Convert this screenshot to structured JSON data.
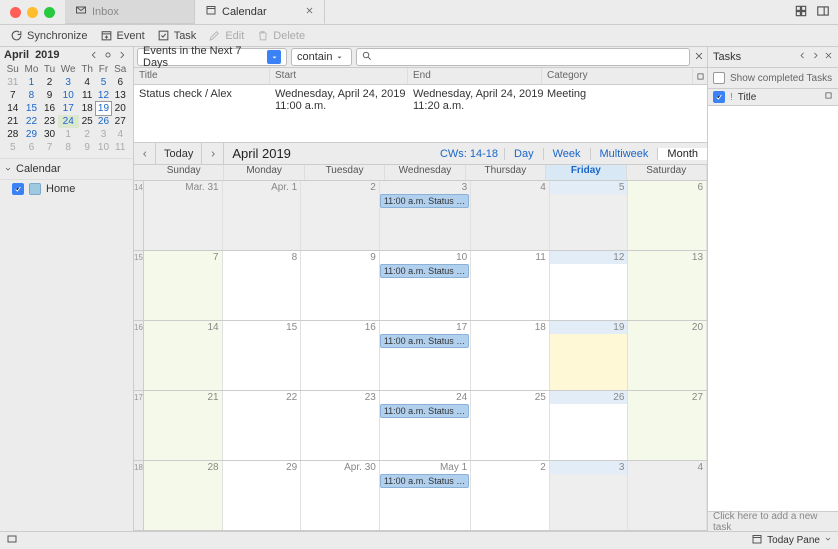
{
  "window": {
    "tabs": [
      {
        "label": "Inbox",
        "active": false
      },
      {
        "label": "Calendar",
        "active": true
      }
    ]
  },
  "toolbar": {
    "synchronize": "Synchronize",
    "event": "Event",
    "task": "Task",
    "edit": "Edit",
    "delete": "Delete"
  },
  "miniCalendar": {
    "month": "April",
    "year": "2019",
    "weekdays": [
      "Su",
      "Mo",
      "Tu",
      "We",
      "Th",
      "Fr",
      "Sa"
    ],
    "grid": [
      [
        {
          "d": "31",
          "off": true
        },
        {
          "d": "1",
          "blue": true
        },
        {
          "d": "2"
        },
        {
          "d": "3",
          "blue": true
        },
        {
          "d": "4"
        },
        {
          "d": "5",
          "blue": true
        },
        {
          "d": "6"
        }
      ],
      [
        {
          "d": "7"
        },
        {
          "d": "8",
          "blue": true
        },
        {
          "d": "9"
        },
        {
          "d": "10",
          "blue": true
        },
        {
          "d": "11"
        },
        {
          "d": "12",
          "blue": true
        },
        {
          "d": "13"
        }
      ],
      [
        {
          "d": "14"
        },
        {
          "d": "15",
          "blue": true
        },
        {
          "d": "16"
        },
        {
          "d": "17",
          "blue": true
        },
        {
          "d": "18"
        },
        {
          "d": "19",
          "blue": true,
          "today": true
        },
        {
          "d": "20"
        }
      ],
      [
        {
          "d": "21"
        },
        {
          "d": "22",
          "blue": true
        },
        {
          "d": "23"
        },
        {
          "d": "24",
          "blue": true,
          "hl": true
        },
        {
          "d": "25"
        },
        {
          "d": "26",
          "blue": true
        },
        {
          "d": "27"
        }
      ],
      [
        {
          "d": "28"
        },
        {
          "d": "29",
          "blue": true
        },
        {
          "d": "30"
        },
        {
          "d": "1",
          "off": true
        },
        {
          "d": "2",
          "off": true
        },
        {
          "d": "3",
          "off": true
        },
        {
          "d": "4",
          "off": true
        }
      ],
      [
        {
          "d": "5",
          "off": true
        },
        {
          "d": "6",
          "off": true
        },
        {
          "d": "7",
          "off": true
        },
        {
          "d": "8",
          "off": true
        },
        {
          "d": "9",
          "off": true
        },
        {
          "d": "10",
          "off": true
        },
        {
          "d": "11",
          "off": true
        }
      ]
    ]
  },
  "calendarTree": {
    "header": "Calendar",
    "items": [
      {
        "name": "Home",
        "checked": true
      }
    ]
  },
  "filter": {
    "preset": "Events in the Next 7 Days",
    "match": "contain",
    "search": ""
  },
  "eventList": {
    "columns": {
      "title": "Title",
      "start": "Start",
      "end": "End",
      "category": "Category"
    },
    "rows": [
      {
        "title": "Status check / Alex",
        "start": "Wednesday, April 24, 2019 11:00 a.m.",
        "end": "Wednesday, April 24, 2019 11:20 a.m.",
        "category": "Meeting"
      }
    ]
  },
  "monthNav": {
    "today": "Today",
    "label": "April 2019",
    "cws": "CWs: 14-18",
    "views": [
      "Day",
      "Week",
      "Multiweek",
      "Month"
    ],
    "activeView": "Month"
  },
  "monthGrid": {
    "dayHeaders": [
      "Sunday",
      "Monday",
      "Tuesday",
      "Wednesday",
      "Thursday",
      "Friday",
      "Saturday"
    ],
    "weeks": [
      {
        "num": "14",
        "days": [
          {
            "label": "Mar. 31",
            "off": true
          },
          {
            "label": "Apr. 1",
            "off": true
          },
          {
            "label": "2",
            "off": true
          },
          {
            "label": "3",
            "off": true,
            "events": [
              {
                "text": "11:00 a.m. Status …"
              }
            ]
          },
          {
            "label": "4",
            "off": true
          },
          {
            "label": "5",
            "off": true
          },
          {
            "label": "6",
            "off": true,
            "we": true
          }
        ]
      },
      {
        "num": "15",
        "days": [
          {
            "label": "7",
            "we": true
          },
          {
            "label": "8"
          },
          {
            "label": "9"
          },
          {
            "label": "10",
            "events": [
              {
                "text": "11:00 a.m. Status …"
              }
            ]
          },
          {
            "label": "11"
          },
          {
            "label": "12"
          },
          {
            "label": "13",
            "we": true
          }
        ]
      },
      {
        "num": "16",
        "days": [
          {
            "label": "14",
            "we": true
          },
          {
            "label": "15"
          },
          {
            "label": "16"
          },
          {
            "label": "17",
            "events": [
              {
                "text": "11:00 a.m. Status …"
              }
            ]
          },
          {
            "label": "18"
          },
          {
            "label": "19",
            "today": true
          },
          {
            "label": "20",
            "we": true
          }
        ]
      },
      {
        "num": "17",
        "days": [
          {
            "label": "21",
            "we": true
          },
          {
            "label": "22"
          },
          {
            "label": "23"
          },
          {
            "label": "24",
            "events": [
              {
                "text": "11:00 a.m. Status …"
              }
            ]
          },
          {
            "label": "25"
          },
          {
            "label": "26"
          },
          {
            "label": "27",
            "we": true
          }
        ]
      },
      {
        "num": "18",
        "days": [
          {
            "label": "28",
            "we": true
          },
          {
            "label": "29"
          },
          {
            "label": "Apr. 30"
          },
          {
            "label": "May 1",
            "events": [
              {
                "text": "11:00 a.m. Status …"
              }
            ]
          },
          {
            "label": "2"
          },
          {
            "label": "3",
            "off": true
          },
          {
            "label": "4",
            "off": true
          }
        ]
      }
    ]
  },
  "tasks": {
    "header": "Tasks",
    "showCompleted": "Show completed Tasks",
    "colTitle": "Title",
    "newTask": "Click here to add a new task"
  },
  "statusbar": {
    "todayPane": "Today Pane"
  }
}
